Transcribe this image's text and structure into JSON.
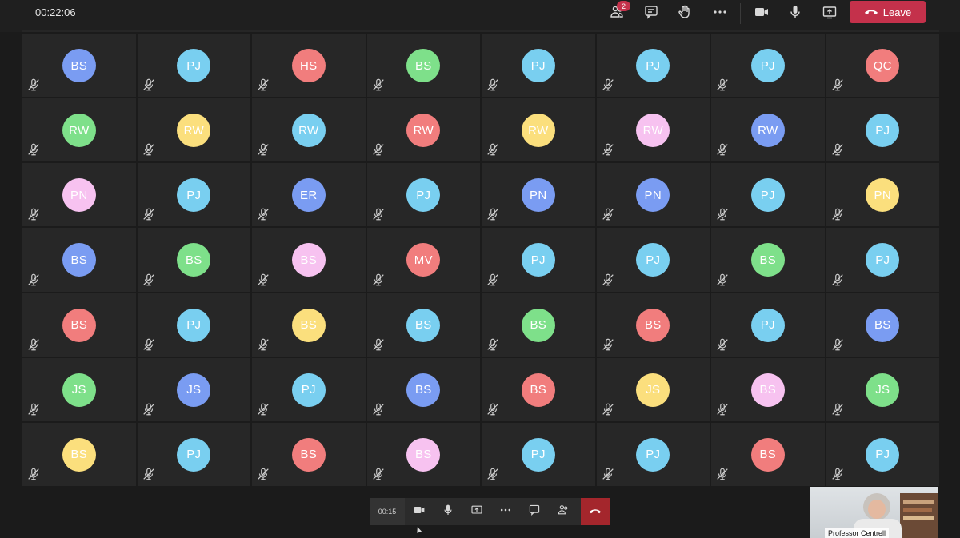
{
  "meeting": {
    "elapsed": "00:22:06",
    "participants_badge": "2",
    "leave_label": "Leave"
  },
  "icons": {
    "participants": "people-icon",
    "chat": "chat-icon",
    "raise_hand": "hand-icon",
    "more": "more-icon",
    "camera": "camera-icon",
    "mic": "mic-icon",
    "share": "share-icon",
    "leave": "hangup-icon",
    "muted": "mic-off-icon"
  },
  "colors": {
    "blue": "#7a9cf2",
    "cyan": "#79cff0",
    "green": "#7ee08a",
    "red": "#f17d7d",
    "yellow": "#fbdf7d",
    "pink": "#f7c2f0",
    "leave": "#c4314b"
  },
  "grid": [
    [
      {
        "i": "BS",
        "c": "blue"
      },
      {
        "i": "PJ",
        "c": "cyan"
      },
      {
        "i": "HS",
        "c": "red"
      },
      {
        "i": "BS",
        "c": "green"
      },
      {
        "i": "PJ",
        "c": "cyan"
      },
      {
        "i": "PJ",
        "c": "cyan"
      },
      {
        "i": "PJ",
        "c": "cyan"
      },
      {
        "i": "QC",
        "c": "red"
      }
    ],
    [
      {
        "i": "RW",
        "c": "green"
      },
      {
        "i": "RW",
        "c": "yellow"
      },
      {
        "i": "RW",
        "c": "cyan"
      },
      {
        "i": "RW",
        "c": "red"
      },
      {
        "i": "RW",
        "c": "yellow"
      },
      {
        "i": "RW",
        "c": "pink"
      },
      {
        "i": "RW",
        "c": "blue"
      },
      {
        "i": "PJ",
        "c": "cyan"
      }
    ],
    [
      {
        "i": "PN",
        "c": "pink"
      },
      {
        "i": "PJ",
        "c": "cyan"
      },
      {
        "i": "ER",
        "c": "blue"
      },
      {
        "i": "PJ",
        "c": "cyan"
      },
      {
        "i": "PN",
        "c": "blue"
      },
      {
        "i": "PN",
        "c": "blue"
      },
      {
        "i": "PJ",
        "c": "cyan"
      },
      {
        "i": "PN",
        "c": "yellow"
      }
    ],
    [
      {
        "i": "BS",
        "c": "blue"
      },
      {
        "i": "BS",
        "c": "green"
      },
      {
        "i": "BS",
        "c": "pink"
      },
      {
        "i": "MV",
        "c": "red"
      },
      {
        "i": "PJ",
        "c": "cyan"
      },
      {
        "i": "PJ",
        "c": "cyan"
      },
      {
        "i": "BS",
        "c": "green"
      },
      {
        "i": "PJ",
        "c": "cyan"
      }
    ],
    [
      {
        "i": "BS",
        "c": "red"
      },
      {
        "i": "PJ",
        "c": "cyan"
      },
      {
        "i": "BS",
        "c": "yellow"
      },
      {
        "i": "BS",
        "c": "cyan"
      },
      {
        "i": "BS",
        "c": "green"
      },
      {
        "i": "BS",
        "c": "red"
      },
      {
        "i": "PJ",
        "c": "cyan"
      },
      {
        "i": "BS",
        "c": "blue"
      }
    ],
    [
      {
        "i": "JS",
        "c": "green"
      },
      {
        "i": "JS",
        "c": "blue"
      },
      {
        "i": "PJ",
        "c": "cyan"
      },
      {
        "i": "BS",
        "c": "blue"
      },
      {
        "i": "BS",
        "c": "red"
      },
      {
        "i": "JS",
        "c": "yellow"
      },
      {
        "i": "BS",
        "c": "pink"
      },
      {
        "i": "JS",
        "c": "green"
      }
    ],
    [
      {
        "i": "BS",
        "c": "yellow"
      },
      {
        "i": "PJ",
        "c": "cyan"
      },
      {
        "i": "BS",
        "c": "red"
      },
      {
        "i": "BS",
        "c": "pink"
      },
      {
        "i": "PJ",
        "c": "cyan"
      },
      {
        "i": "PJ",
        "c": "cyan"
      },
      {
        "i": "BS",
        "c": "red"
      },
      {
        "i": "PJ",
        "c": "cyan"
      }
    ]
  ],
  "mini_bar": {
    "elapsed": "00:15"
  },
  "presenter": {
    "name": "Professor Centrell"
  }
}
